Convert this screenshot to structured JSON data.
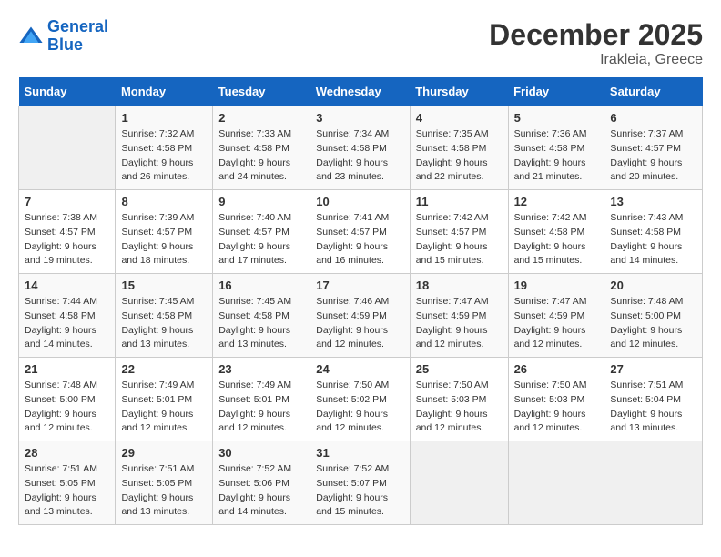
{
  "header": {
    "logo_general": "General",
    "logo_blue": "Blue",
    "month_year": "December 2025",
    "location": "Irakleia, Greece"
  },
  "calendar": {
    "days_of_week": [
      "Sunday",
      "Monday",
      "Tuesday",
      "Wednesday",
      "Thursday",
      "Friday",
      "Saturday"
    ],
    "weeks": [
      [
        {
          "day": "",
          "sunrise": "",
          "sunset": "",
          "daylight": ""
        },
        {
          "day": "1",
          "sunrise": "Sunrise: 7:32 AM",
          "sunset": "Sunset: 4:58 PM",
          "daylight": "Daylight: 9 hours and 26 minutes."
        },
        {
          "day": "2",
          "sunrise": "Sunrise: 7:33 AM",
          "sunset": "Sunset: 4:58 PM",
          "daylight": "Daylight: 9 hours and 24 minutes."
        },
        {
          "day": "3",
          "sunrise": "Sunrise: 7:34 AM",
          "sunset": "Sunset: 4:58 PM",
          "daylight": "Daylight: 9 hours and 23 minutes."
        },
        {
          "day": "4",
          "sunrise": "Sunrise: 7:35 AM",
          "sunset": "Sunset: 4:58 PM",
          "daylight": "Daylight: 9 hours and 22 minutes."
        },
        {
          "day": "5",
          "sunrise": "Sunrise: 7:36 AM",
          "sunset": "Sunset: 4:58 PM",
          "daylight": "Daylight: 9 hours and 21 minutes."
        },
        {
          "day": "6",
          "sunrise": "Sunrise: 7:37 AM",
          "sunset": "Sunset: 4:57 PM",
          "daylight": "Daylight: 9 hours and 20 minutes."
        }
      ],
      [
        {
          "day": "7",
          "sunrise": "Sunrise: 7:38 AM",
          "sunset": "Sunset: 4:57 PM",
          "daylight": "Daylight: 9 hours and 19 minutes."
        },
        {
          "day": "8",
          "sunrise": "Sunrise: 7:39 AM",
          "sunset": "Sunset: 4:57 PM",
          "daylight": "Daylight: 9 hours and 18 minutes."
        },
        {
          "day": "9",
          "sunrise": "Sunrise: 7:40 AM",
          "sunset": "Sunset: 4:57 PM",
          "daylight": "Daylight: 9 hours and 17 minutes."
        },
        {
          "day": "10",
          "sunrise": "Sunrise: 7:41 AM",
          "sunset": "Sunset: 4:57 PM",
          "daylight": "Daylight: 9 hours and 16 minutes."
        },
        {
          "day": "11",
          "sunrise": "Sunrise: 7:42 AM",
          "sunset": "Sunset: 4:57 PM",
          "daylight": "Daylight: 9 hours and 15 minutes."
        },
        {
          "day": "12",
          "sunrise": "Sunrise: 7:42 AM",
          "sunset": "Sunset: 4:58 PM",
          "daylight": "Daylight: 9 hours and 15 minutes."
        },
        {
          "day": "13",
          "sunrise": "Sunrise: 7:43 AM",
          "sunset": "Sunset: 4:58 PM",
          "daylight": "Daylight: 9 hours and 14 minutes."
        }
      ],
      [
        {
          "day": "14",
          "sunrise": "Sunrise: 7:44 AM",
          "sunset": "Sunset: 4:58 PM",
          "daylight": "Daylight: 9 hours and 14 minutes."
        },
        {
          "day": "15",
          "sunrise": "Sunrise: 7:45 AM",
          "sunset": "Sunset: 4:58 PM",
          "daylight": "Daylight: 9 hours and 13 minutes."
        },
        {
          "day": "16",
          "sunrise": "Sunrise: 7:45 AM",
          "sunset": "Sunset: 4:58 PM",
          "daylight": "Daylight: 9 hours and 13 minutes."
        },
        {
          "day": "17",
          "sunrise": "Sunrise: 7:46 AM",
          "sunset": "Sunset: 4:59 PM",
          "daylight": "Daylight: 9 hours and 12 minutes."
        },
        {
          "day": "18",
          "sunrise": "Sunrise: 7:47 AM",
          "sunset": "Sunset: 4:59 PM",
          "daylight": "Daylight: 9 hours and 12 minutes."
        },
        {
          "day": "19",
          "sunrise": "Sunrise: 7:47 AM",
          "sunset": "Sunset: 4:59 PM",
          "daylight": "Daylight: 9 hours and 12 minutes."
        },
        {
          "day": "20",
          "sunrise": "Sunrise: 7:48 AM",
          "sunset": "Sunset: 5:00 PM",
          "daylight": "Daylight: 9 hours and 12 minutes."
        }
      ],
      [
        {
          "day": "21",
          "sunrise": "Sunrise: 7:48 AM",
          "sunset": "Sunset: 5:00 PM",
          "daylight": "Daylight: 9 hours and 12 minutes."
        },
        {
          "day": "22",
          "sunrise": "Sunrise: 7:49 AM",
          "sunset": "Sunset: 5:01 PM",
          "daylight": "Daylight: 9 hours and 12 minutes."
        },
        {
          "day": "23",
          "sunrise": "Sunrise: 7:49 AM",
          "sunset": "Sunset: 5:01 PM",
          "daylight": "Daylight: 9 hours and 12 minutes."
        },
        {
          "day": "24",
          "sunrise": "Sunrise: 7:50 AM",
          "sunset": "Sunset: 5:02 PM",
          "daylight": "Daylight: 9 hours and 12 minutes."
        },
        {
          "day": "25",
          "sunrise": "Sunrise: 7:50 AM",
          "sunset": "Sunset: 5:03 PM",
          "daylight": "Daylight: 9 hours and 12 minutes."
        },
        {
          "day": "26",
          "sunrise": "Sunrise: 7:50 AM",
          "sunset": "Sunset: 5:03 PM",
          "daylight": "Daylight: 9 hours and 12 minutes."
        },
        {
          "day": "27",
          "sunrise": "Sunrise: 7:51 AM",
          "sunset": "Sunset: 5:04 PM",
          "daylight": "Daylight: 9 hours and 13 minutes."
        }
      ],
      [
        {
          "day": "28",
          "sunrise": "Sunrise: 7:51 AM",
          "sunset": "Sunset: 5:05 PM",
          "daylight": "Daylight: 9 hours and 13 minutes."
        },
        {
          "day": "29",
          "sunrise": "Sunrise: 7:51 AM",
          "sunset": "Sunset: 5:05 PM",
          "daylight": "Daylight: 9 hours and 13 minutes."
        },
        {
          "day": "30",
          "sunrise": "Sunrise: 7:52 AM",
          "sunset": "Sunset: 5:06 PM",
          "daylight": "Daylight: 9 hours and 14 minutes."
        },
        {
          "day": "31",
          "sunrise": "Sunrise: 7:52 AM",
          "sunset": "Sunset: 5:07 PM",
          "daylight": "Daylight: 9 hours and 15 minutes."
        },
        {
          "day": "",
          "sunrise": "",
          "sunset": "",
          "daylight": ""
        },
        {
          "day": "",
          "sunrise": "",
          "sunset": "",
          "daylight": ""
        },
        {
          "day": "",
          "sunrise": "",
          "sunset": "",
          "daylight": ""
        }
      ]
    ]
  }
}
